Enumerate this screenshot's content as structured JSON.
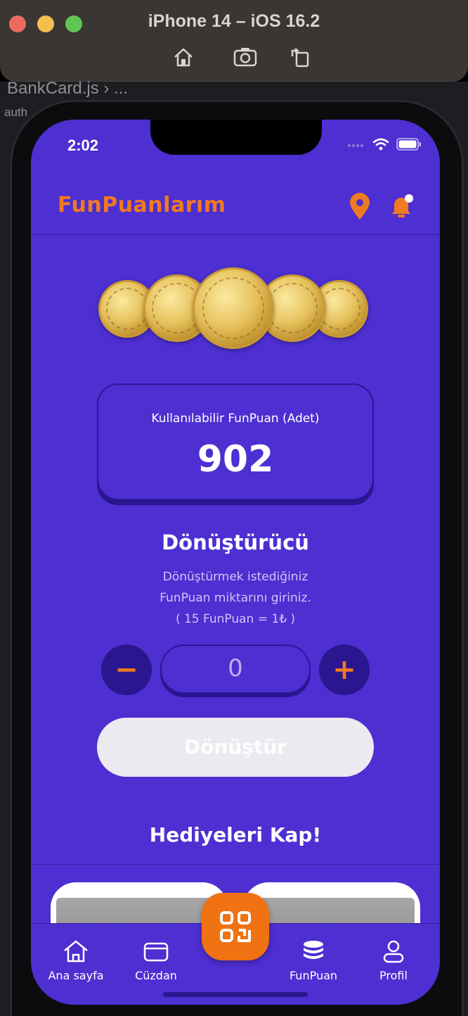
{
  "simulator": {
    "title": "iPhone 14 – iOS 16.2",
    "tools": [
      "home-icon",
      "screenshot-icon",
      "rotate-icon"
    ]
  },
  "editor": {
    "tab_label": "BankCard.js › ...",
    "author_label": "auth"
  },
  "status_bar": {
    "time": "2:02"
  },
  "header": {
    "brand": "FunPuanlarım",
    "icons": [
      "location-pin-icon",
      "bell-icon"
    ]
  },
  "balance": {
    "label": "Kullanılabilir FunPuan (Adet)",
    "value": "902"
  },
  "converter": {
    "title": "Dönüştürücü",
    "desc_line1": "Dönüştürmek istediğiniz",
    "desc_line2": "FunPuan miktarını giriniz.",
    "rate": "( 15 FunPuan = 1₺ )",
    "minus": "−",
    "plus": "+",
    "quantity": "0",
    "button": "Dönüştür"
  },
  "gifts": {
    "title": "Hediyeleri Kap!"
  },
  "tabbar": {
    "items": [
      {
        "label": "Ana sayfa",
        "icon": "home-icon"
      },
      {
        "label": "Cüzdan",
        "icon": "wallet-icon"
      },
      {
        "label": "",
        "icon": "qr-code-icon"
      },
      {
        "label": "FunPuan",
        "icon": "coins-stack-icon"
      },
      {
        "label": "Profil",
        "icon": "profile-icon"
      }
    ]
  },
  "colors": {
    "background": "#4d2fd2",
    "accent": "#f07a22",
    "dark": "#2a168e"
  }
}
